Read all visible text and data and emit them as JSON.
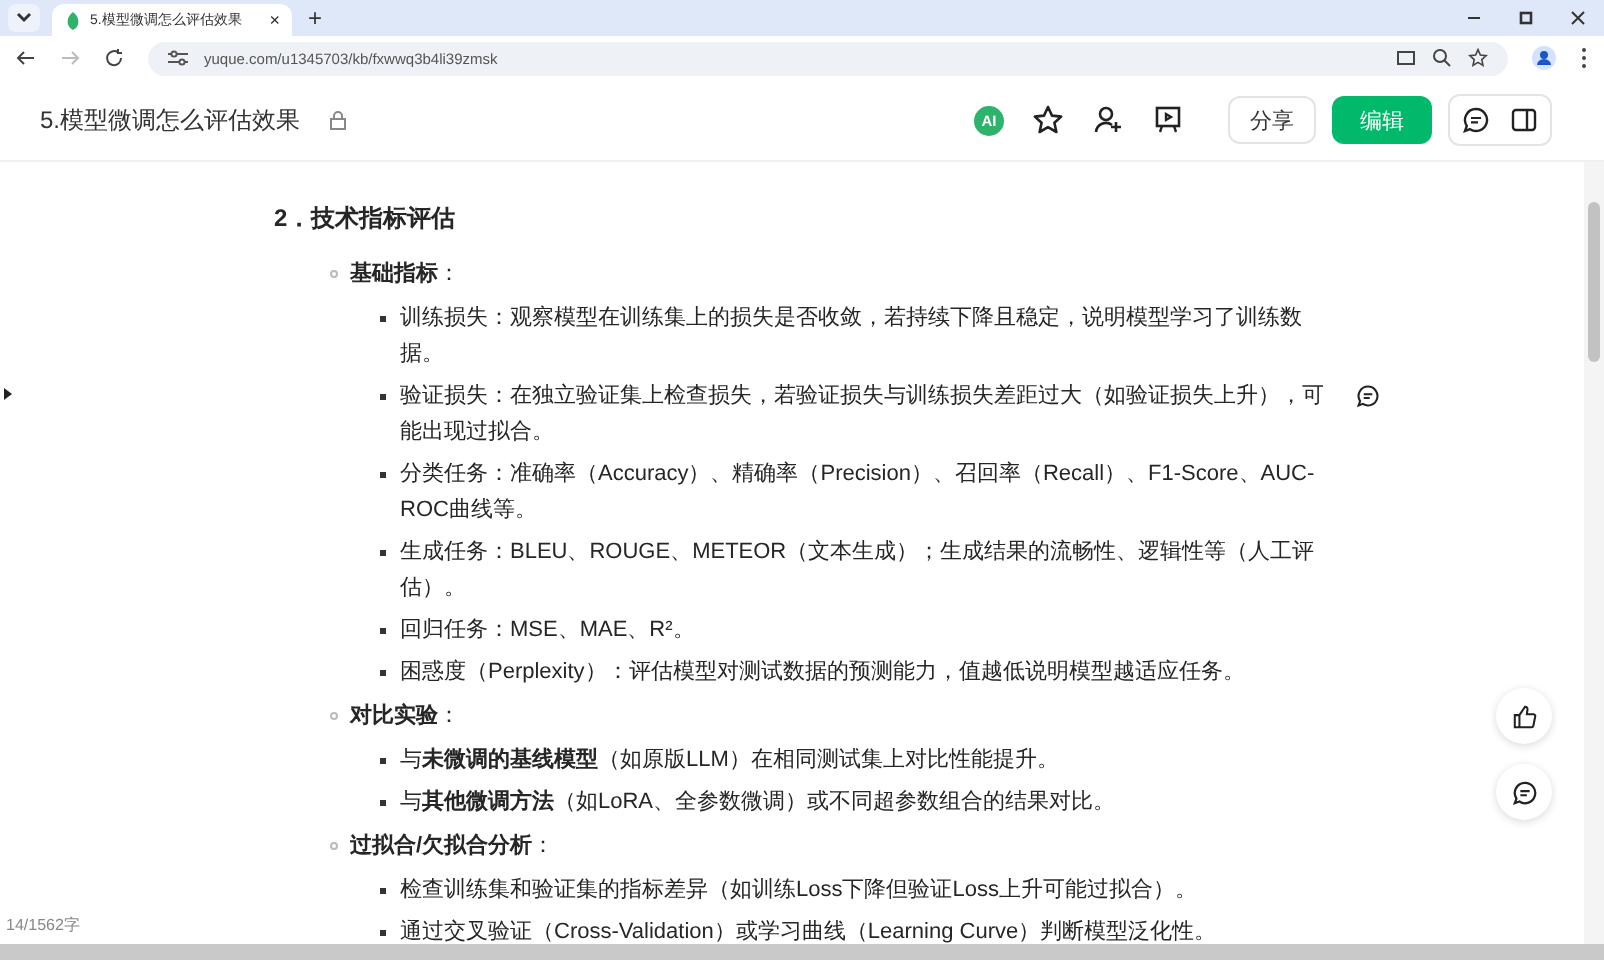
{
  "browser": {
    "tab": {
      "title": "5.模型微调怎么评估效果",
      "close": "×",
      "selected": true
    },
    "new_tab": "+",
    "url": "yuque.com/u1345703/kb/fxwwq3b4li39zmsk"
  },
  "doc_header": {
    "title": "5.模型微调怎么评估效果",
    "ai_badge": "AI",
    "share_button": "分享",
    "edit_button": "编辑"
  },
  "content": {
    "heading": "2．技术指标评估",
    "sections": [
      {
        "label": "**基础指标**：",
        "children": [
          {
            "text": "训练损失：观察模型在训练集上的损失是否收敛，若持续下降且稳定，说明模型学习了训练数据。",
            "comment": false
          },
          {
            "text": "验证损失：在独立验证集上检查损失，若验证损失与训练损失差距过大（如验证损失上升），可能出现过拟合。",
            "comment": true
          },
          {
            "text": "分类任务：准确率（Accuracy）、精确率（Precision）、召回率（Recall）、F1-Score、AUC-ROC曲线等。",
            "comment": false
          },
          {
            "text": "生成任务：BLEU、ROUGE、METEOR（文本生成）；生成结果的流畅性、逻辑性等（人工评估）。",
            "comment": false
          },
          {
            "text": "回归任务：MSE、MAE、R²。",
            "comment": false
          },
          {
            "text": "困惑度（Perplexity）：评估模型对测试数据的预测能力，值越低说明模型越适应任务。",
            "comment": false
          }
        ]
      },
      {
        "label": "**对比实验**：",
        "children": [
          {
            "text": "与**未微调的基线模型**（如原版LLM）在相同测试集上对比性能提升。",
            "comment": false
          },
          {
            "text": "与**其他微调方法**（如LoRA、全参数微调）或不同超参数组合的结果对比。",
            "comment": false
          }
        ]
      },
      {
        "label": "**过拟合/欠拟合分析**：",
        "children": [
          {
            "text": "检查训练集和验证集的指标差异（如训练Loss下降但验证Loss上升可能过拟合）。",
            "comment": false
          },
          {
            "text": "通过交叉验证（Cross-Validation）或学习曲线（Learning Curve）判断模型泛化性。",
            "comment": false
          }
        ]
      }
    ]
  },
  "word_count": "14/1562字"
}
